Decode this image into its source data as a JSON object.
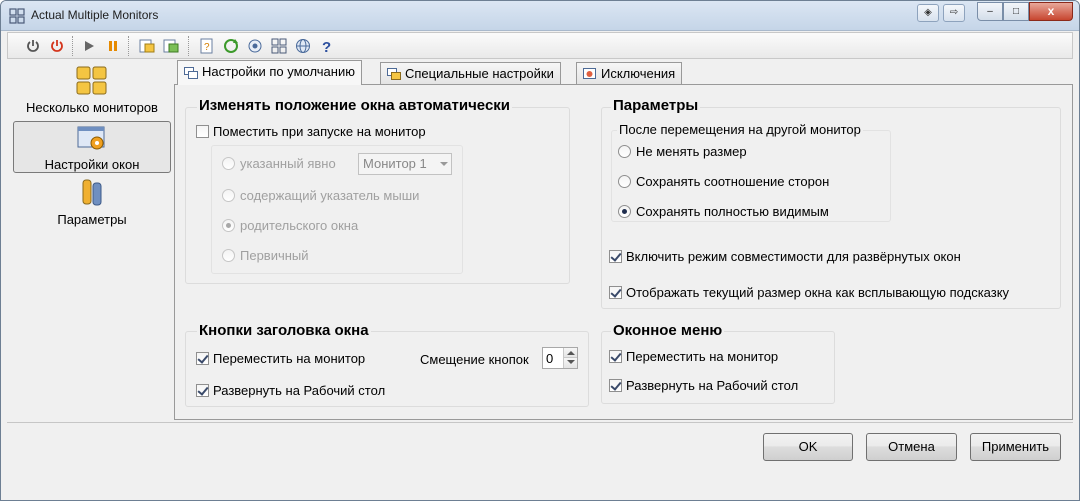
{
  "window": {
    "title": "Actual Multiple Monitors",
    "controls": {
      "minimize": "–",
      "maximize": "□",
      "close": "x"
    }
  },
  "toolbar": {
    "icons": [
      "power-icon",
      "power-off-icon",
      "play-icon",
      "pause-icon",
      "export-icon",
      "import-icon",
      "help-file-icon",
      "update-icon",
      "support-icon",
      "about-icon",
      "web-icon",
      "question-icon"
    ]
  },
  "nav": {
    "items": [
      {
        "label": "Несколько мониторов",
        "icon": "monitors-grid-icon"
      },
      {
        "label": "Настройки окон",
        "icon": "window-settings-icon"
      },
      {
        "label": "Параметры",
        "icon": "tools-icon"
      }
    ],
    "selected_index": 1
  },
  "tabs": [
    {
      "label": "Настройки по умолчанию",
      "active": true
    },
    {
      "label": "Специальные настройки",
      "active": false
    },
    {
      "label": "Исключения",
      "active": false
    }
  ],
  "auto_position": {
    "title": "Изменять положение окна автоматически",
    "place_on_start": {
      "label": "Поместить при запуске на монитор",
      "checked": false
    },
    "options": [
      {
        "label": "указанный явно",
        "selected": false
      },
      {
        "label": "содержащий указатель мыши",
        "selected": false
      },
      {
        "label": "родительского окна",
        "selected": true
      },
      {
        "label": "Первичный",
        "selected": false
      }
    ],
    "monitor_select": "Монитор 1"
  },
  "parameters": {
    "title": "Параметры",
    "after_move_title": "После перемещения на другой монитор",
    "after_move_options": [
      {
        "label": "Не менять размер",
        "selected": false
      },
      {
        "label": "Сохранять соотношение сторон",
        "selected": false
      },
      {
        "label": "Сохранять полностью видимым",
        "selected": true
      }
    ],
    "compat_mode": {
      "label": "Включить режим совместимости для развёрнутых окон",
      "checked": true
    },
    "show_size_tooltip": {
      "label": "Отображать текущий размер окна как всплывающую подсказку",
      "checked": true
    }
  },
  "title_buttons": {
    "title": "Кнопки заголовка окна",
    "move_to_monitor": {
      "label": "Переместить на монитор",
      "checked": true
    },
    "maximize_desktop": {
      "label": "Развернуть на Рабочий стол",
      "checked": true
    },
    "offset_label": "Смещение кнопок",
    "offset_value": "0"
  },
  "window_menu": {
    "title": "Оконное меню",
    "move_to_monitor": {
      "label": "Переместить на монитор",
      "checked": true
    },
    "maximize_desktop": {
      "label": "Развернуть на Рабочий стол",
      "checked": true
    }
  },
  "dialog_buttons": {
    "ok": "OK",
    "cancel": "Отмена",
    "apply": "Применить"
  }
}
